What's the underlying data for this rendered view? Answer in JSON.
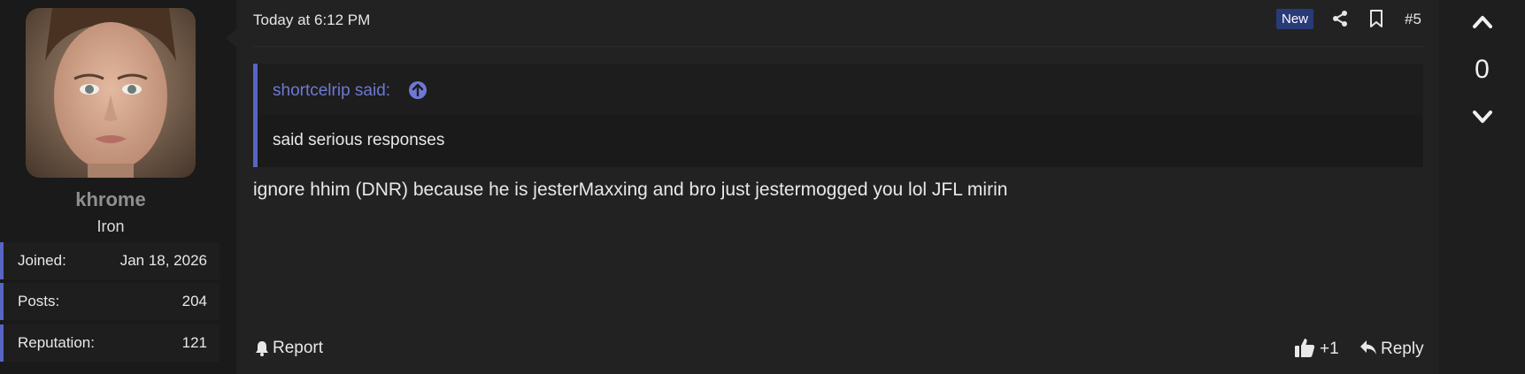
{
  "user": {
    "name": "khrome",
    "title": "Iron",
    "stats": {
      "joined_label": "Joined:",
      "joined_value": "Jan 18, 2026",
      "posts_label": "Posts:",
      "posts_value": "204",
      "reputation_label": "Reputation:",
      "reputation_value": "121"
    }
  },
  "post": {
    "timestamp": "Today at 6:12 PM",
    "badge": "New",
    "number": "#5",
    "quote": {
      "author": "shortcelrip said:",
      "text": "said serious responses"
    },
    "message": "ignore hhim (DNR) because he is jesterMaxxing and bro just jestermogged you lol JFL mirin",
    "actions": {
      "report_label": "Report",
      "like_label": "+1",
      "reply_label": "Reply"
    }
  },
  "vote": {
    "score": "0"
  },
  "icons": {
    "share": "share-icon",
    "bookmark": "bookmark-icon",
    "goto": "arrow-up-circle-icon",
    "report": "bell-icon",
    "like": "thumbs-up-icon",
    "reply": "reply-icon",
    "upvote": "chevron-up-icon",
    "downvote": "chevron-down-icon"
  },
  "colors": {
    "accent": "#5865c4",
    "quote_author": "#6d79d4",
    "badge_bg": "#283a78"
  }
}
